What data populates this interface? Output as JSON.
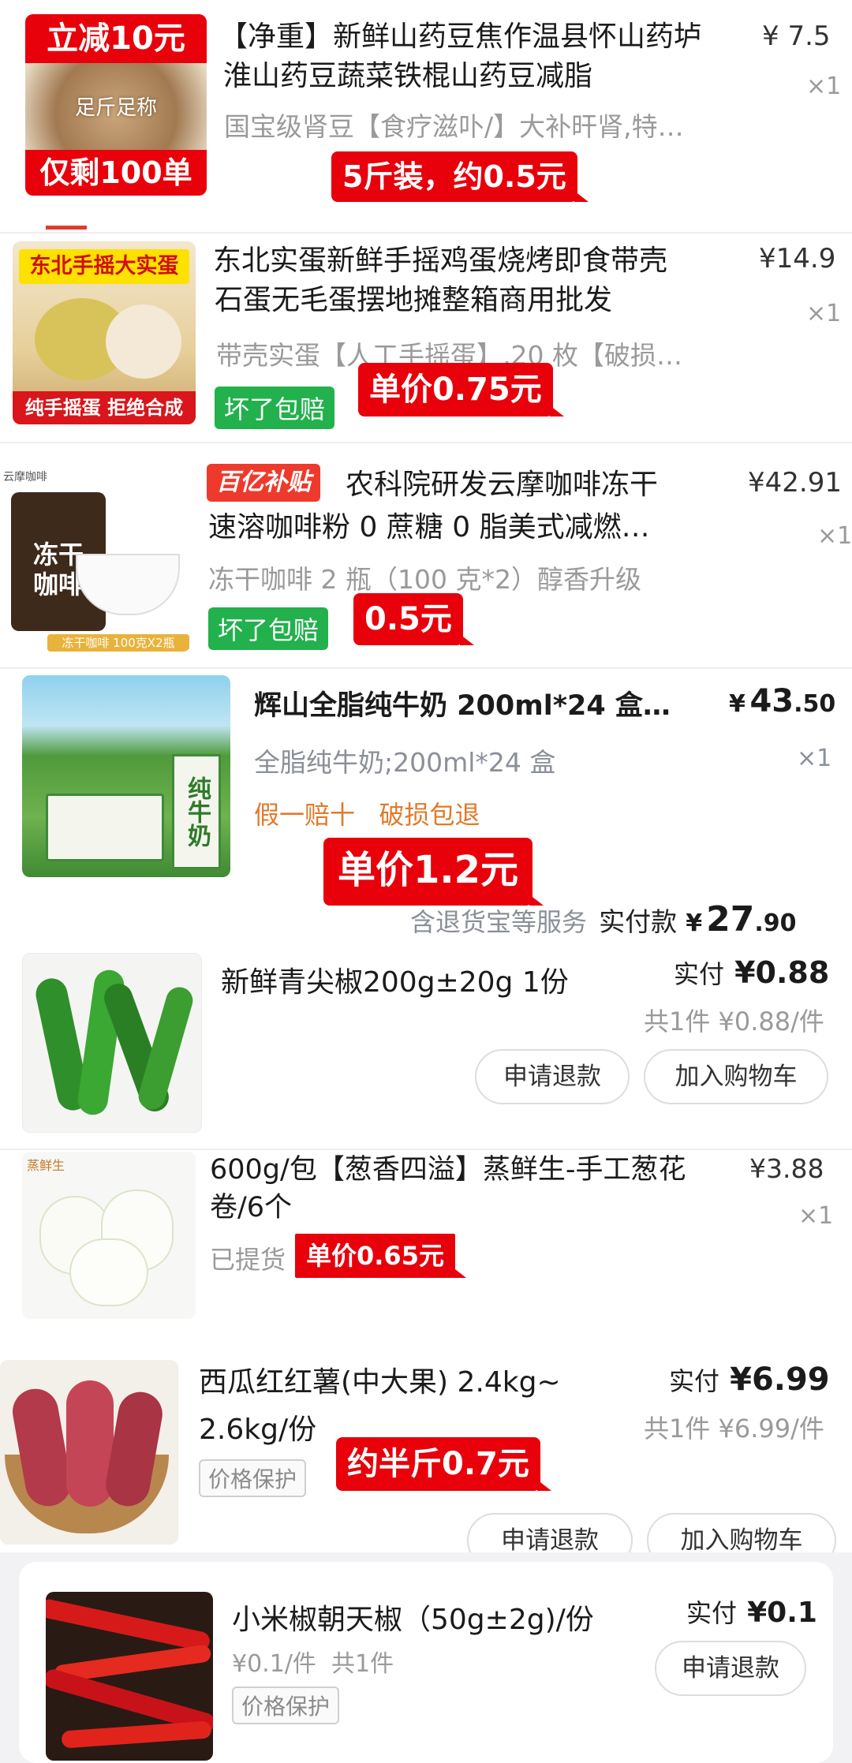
{
  "items": [
    {
      "badge_top": "立减10元",
      "badge_mid": "足斤足称",
      "badge_bottom": "仅剩100单",
      "title_line1": "【净重】新鲜山药豆焦作温县怀山药垆",
      "title_line2": "淮山药豆蔬菜铁棍山药豆减脂",
      "sub": "国宝级肾豆【食疗滋卟/】大补旰肾,特…",
      "price": "¥ 7.5",
      "qty": "×1",
      "annotation": "5斤装，约0.5元"
    },
    {
      "img_banner": "东北手摇大实蛋",
      "img_footer": "纯手摇蛋 拒绝合成",
      "title_line1": "东北实蛋新鲜手摇鸡蛋烧烤即食带壳",
      "title_line2": "石蛋无毛蛋摆地摊整箱商用批发",
      "sub": "带壳实蛋【人工手摇蛋】,20 枚【破损…",
      "badge": "坏了包赔",
      "price": "¥14.9",
      "qty": "×1",
      "annotation": "单价0.75元"
    },
    {
      "brand_tag": "百亿补贴",
      "img_brand": "云摩咖啡",
      "img_text": "冻干\n咖啡",
      "img_footer": "冻干咖啡 100克X2瓶",
      "title_line1": "农科院研发云摩咖啡冻干",
      "title_line2": "速溶咖啡粉 0 蔗糖 0 脂美式减燃…",
      "sub": "冻干咖啡 2 瓶（100 克*2）醇香升级",
      "badge": "坏了包赔",
      "price": "¥42.91",
      "qty": "×1",
      "annotation": "0.5元"
    },
    {
      "img_text": "纯牛奶",
      "title": "辉山全脂纯牛奶 200ml*24 盒…",
      "sub": "全脂纯牛奶;200ml*24 盒",
      "service": "假一赔十   破损包退",
      "price_symbol": "¥",
      "price_int": "43",
      "price_dec": ".50",
      "qty": "×1",
      "annotation": "单价1.2元",
      "footer_service": "含退货宝等服务",
      "footer_label": "实付款",
      "footer_symbol": "¥",
      "footer_int": "27",
      "footer_dec": ".90"
    },
    {
      "title": "新鲜青尖椒200g±20g 1份",
      "paid_label": "实付",
      "paid_value": "¥0.88",
      "unit_info": "共1件 ¥0.88/件",
      "refund_button": "申请退款",
      "cart_button": "加入购物车"
    },
    {
      "img_brand": "蒸鲜生",
      "title_line1": "600g/包【葱香四溢】蒸鲜生-手工葱花",
      "title_line2": "卷/6个",
      "status": "已提货",
      "price": "¥3.88",
      "qty": "×1",
      "annotation": "单价0.65元"
    },
    {
      "title_line1": "西瓜红红薯(中大果) 2.4kg~",
      "title_line2": "2.6kg/份",
      "badge": "价格保护",
      "paid_label": "实付",
      "paid_value": "¥6.99",
      "unit_info": "共1件 ¥6.99/件",
      "annotation": "约半斤0.7元",
      "refund_button": "申请退款",
      "cart_button": "加入购物车"
    },
    {
      "title": "小米椒朝天椒（50g±2g)/份",
      "unit_info": "¥0.1/件  共1件",
      "badge": "价格保护",
      "paid_label": "实付",
      "paid_value": "¥0.1",
      "refund_button": "申请退款"
    }
  ],
  "colors": {
    "annotation_red": "#e8000b",
    "green_badge": "#22b14c",
    "service_orange": "#e07a2b"
  }
}
